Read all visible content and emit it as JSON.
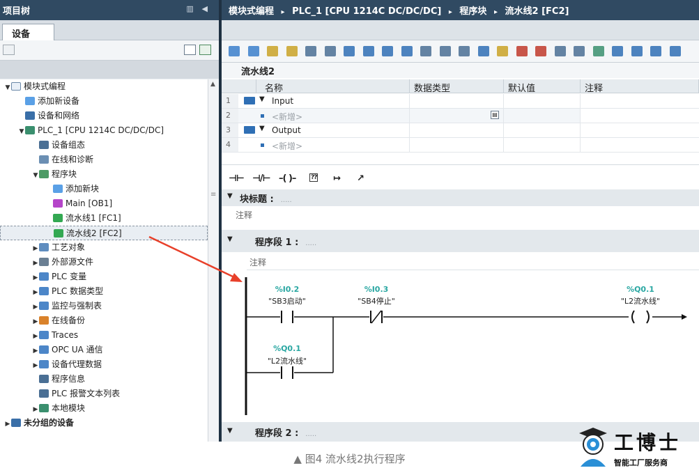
{
  "project_tree": {
    "title": "项目树",
    "tab": "设备",
    "items": [
      {
        "label": "模块式编程",
        "icon": "project-icon",
        "color": "#e9f0f8",
        "expander": "▼"
      },
      {
        "label": "添加新设备",
        "icon": "add-device-icon",
        "color": "#5aa0e6",
        "expander": ""
      },
      {
        "label": "设备和网络",
        "icon": "network-icon",
        "color": "#3a6fa8",
        "expander": ""
      },
      {
        "label": "PLC_1 [CPU 1214C DC/DC/DC]",
        "icon": "plc-icon",
        "color": "#3a8f6e",
        "expander": "▼"
      },
      {
        "label": "设备组态",
        "icon": "device-config-icon",
        "color": "#4a6f94",
        "expander": ""
      },
      {
        "label": "在线和诊断",
        "icon": "online-diagnostics-icon",
        "color": "#6b8fb3",
        "expander": ""
      },
      {
        "label": "程序块",
        "icon": "program-blocks-icon",
        "color": "#4c9a64",
        "expander": "▼"
      },
      {
        "label": "添加新块",
        "icon": "add-block-icon",
        "color": "#5aa0e6",
        "expander": ""
      },
      {
        "label": "Main [OB1]",
        "icon": "ob-block-icon",
        "color": "#b545c9",
        "expander": ""
      },
      {
        "label": "流水线1 [FC1]",
        "icon": "fc-block-icon",
        "color": "#33a852",
        "expander": ""
      },
      {
        "label": "流水线2 [FC2]",
        "icon": "fc-block-icon",
        "color": "#33a852",
        "expander": "",
        "selected": true
      },
      {
        "label": "工艺对象",
        "icon": "technology-objects-icon",
        "color": "#5f8dbf",
        "expander": "▶"
      },
      {
        "label": "外部源文件",
        "icon": "external-source-icon",
        "color": "#6a7f93",
        "expander": "▶"
      },
      {
        "label": "PLC 变量",
        "icon": "plc-tags-icon",
        "color": "#4c86c8",
        "expander": "▶"
      },
      {
        "label": "PLC 数据类型",
        "icon": "plc-data-types-icon",
        "color": "#4c86c8",
        "expander": "▶"
      },
      {
        "label": "监控与强制表",
        "icon": "watch-table-icon",
        "color": "#4c86c8",
        "expander": "▶"
      },
      {
        "label": "在线备份",
        "icon": "online-backup-icon",
        "color": "#d9822b",
        "expander": "▶"
      },
      {
        "label": "Traces",
        "icon": "traces-icon",
        "color": "#4c86c8",
        "expander": "▶"
      },
      {
        "label": "OPC UA 通信",
        "icon": "opc-ua-icon",
        "color": "#4c86c8",
        "expander": "▶"
      },
      {
        "label": "设备代理数据",
        "icon": "device-proxy-icon",
        "color": "#4c86c8",
        "expander": "▶"
      },
      {
        "label": "程序信息",
        "icon": "program-info-icon",
        "color": "#4a6f94",
        "expander": ""
      },
      {
        "label": "PLC 报警文本列表",
        "icon": "alarm-text-icon",
        "color": "#4a6f94",
        "expander": ""
      },
      {
        "label": "本地模块",
        "icon": "local-modules-icon",
        "color": "#3a8f6e",
        "expander": "▶"
      },
      {
        "label": "未分组的设备",
        "icon": "ungrouped-devices-icon",
        "color": "#3a6fa8",
        "expander": "▶",
        "bold": true
      }
    ]
  },
  "breadcrumb": {
    "parts": [
      "模块式编程",
      "PLC_1 [CPU 1214C DC/DC/DC]",
      "程序块",
      "流水线2 [FC2]"
    ],
    "separator": "▸"
  },
  "block_name": "流水线2",
  "interface": {
    "headers": [
      "名称",
      "数据类型",
      "默认值",
      "注释"
    ],
    "rows": [
      {
        "num": "1",
        "name": "Input",
        "section": true
      },
      {
        "num": "2",
        "name": "<新增>",
        "section": false
      },
      {
        "num": "3",
        "name": "Output",
        "section": true
      },
      {
        "num": "4",
        "name": "<新增>",
        "section": false
      }
    ]
  },
  "ladder_toolbar": [
    "⊣⊢",
    "⊣/⊢",
    "–( )–",
    "??",
    "↦",
    "↗"
  ],
  "block_title": {
    "label": "块标题 :",
    "dots": "....."
  },
  "block_comment": "注释",
  "network1": {
    "label": "程序段 1 :",
    "dots": ".....",
    "comment": "注释",
    "contacts": [
      {
        "address": "%I0.2",
        "tag": "\"SB3启动\""
      },
      {
        "address": "%I0.3",
        "tag": "\"SB4停止\""
      },
      {
        "address": "%Q0.1",
        "tag": "\"L2流水线\""
      }
    ],
    "coil": {
      "address": "%Q0.1",
      "tag": "\"L2流水线\""
    }
  },
  "network2": {
    "label": "程序段 2 :",
    "dots": "....."
  },
  "caption": "▲ 图4 流水线2执行程序",
  "logo": {
    "main": "工博士",
    "sub": "智能工厂服务商"
  },
  "colors": {
    "title_bar": "#304a62",
    "address": "#2aa7a2",
    "arrow": "#e8402a"
  }
}
